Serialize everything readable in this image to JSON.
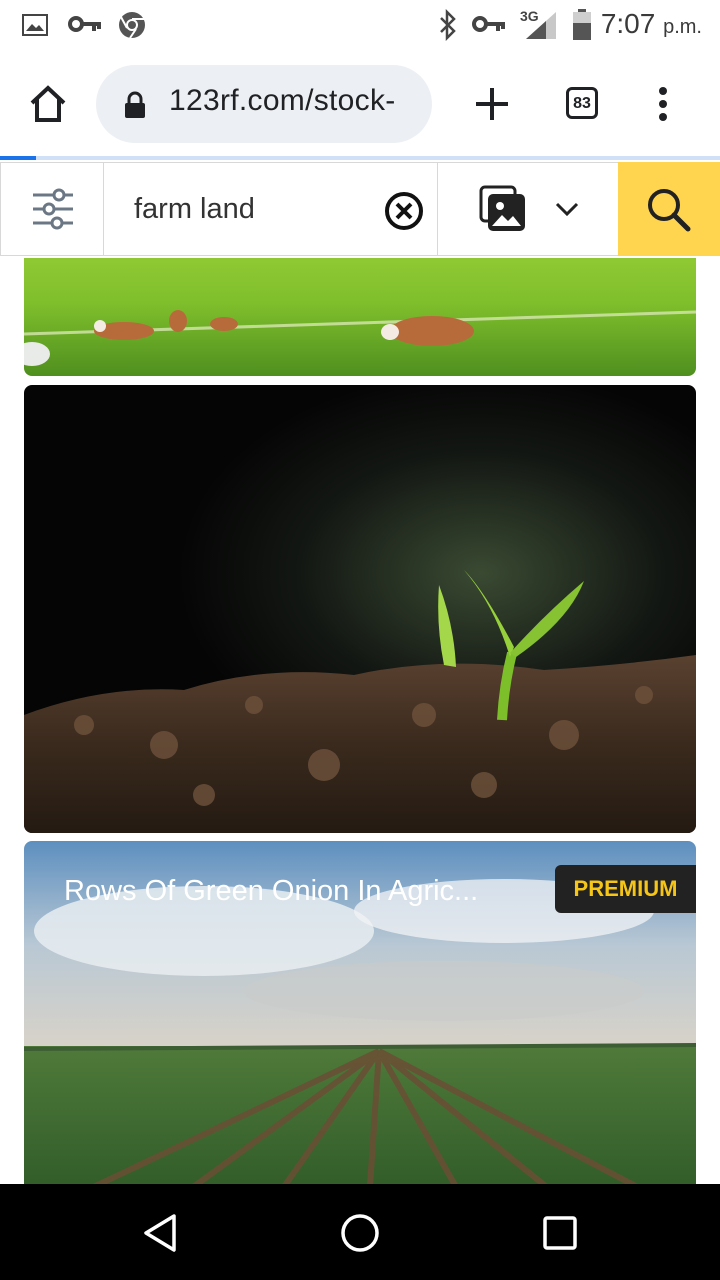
{
  "status_bar": {
    "time": "7:07",
    "ampm": "p.m.",
    "network": "3G",
    "icons": [
      "gallery-icon",
      "vpn-key-icon",
      "chrome-icon",
      "bluetooth-icon",
      "vpn-key-icon",
      "signal-icon",
      "battery-icon"
    ]
  },
  "browser": {
    "url": "123rf.com/stock-",
    "tab_count": "83",
    "load_progress": 0.05
  },
  "search": {
    "query": "farm land"
  },
  "results": [
    {
      "title": "",
      "premium": false,
      "subject": "cows grazing in green pasture"
    },
    {
      "title": "",
      "premium": false,
      "subject": "seedling sprouting from soil"
    },
    {
      "title": "Rows Of Green Onion In Agric...",
      "premium": true,
      "badge": "PREMIUM",
      "subject": "rows of green onion field under cloudy sky"
    }
  ],
  "colors": {
    "accent": "#ffd54f",
    "badge_text": "#f5c518",
    "progress": "#1a73e8"
  }
}
